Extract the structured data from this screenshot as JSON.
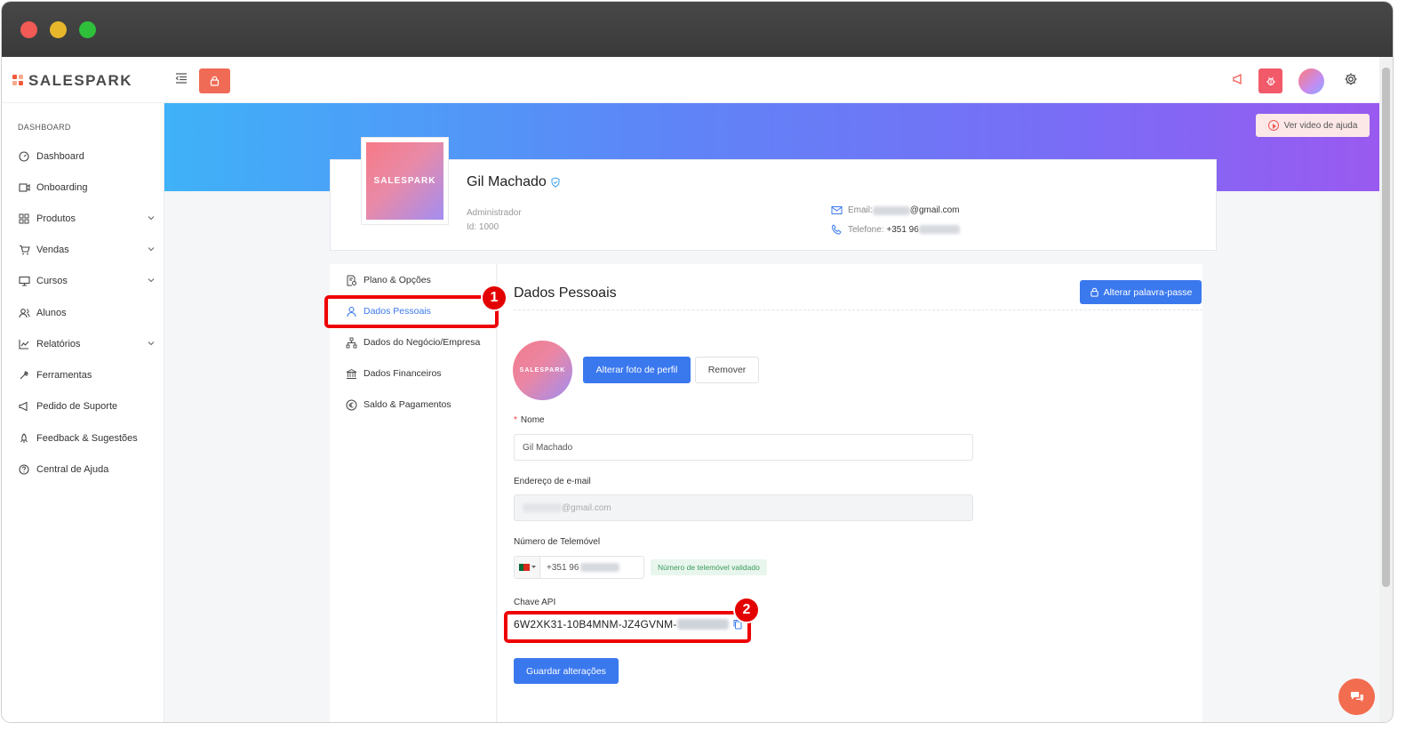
{
  "app": {
    "brand": "SALESPARK"
  },
  "sidebar": {
    "section": "DASHBOARD",
    "items": [
      {
        "label": "Dashboard",
        "icon": "gauge-icon"
      },
      {
        "label": "Onboarding",
        "icon": "video-icon"
      },
      {
        "label": "Produtos",
        "icon": "grid-icon",
        "expandable": true
      },
      {
        "label": "Vendas",
        "icon": "cart-icon",
        "expandable": true
      },
      {
        "label": "Cursos",
        "icon": "monitor-icon",
        "expandable": true
      },
      {
        "label": "Alunos",
        "icon": "users-icon"
      },
      {
        "label": "Relatórios",
        "icon": "chart-icon",
        "expandable": true
      },
      {
        "label": "Ferramentas",
        "icon": "wrench-icon"
      },
      {
        "label": "Pedido de Suporte",
        "icon": "megaphone-icon"
      },
      {
        "label": "Feedback & Sugestões",
        "icon": "rocket-icon"
      },
      {
        "label": "Central de Ajuda",
        "icon": "help-icon"
      }
    ]
  },
  "banner": {
    "help_button": "Ver video de ajuda"
  },
  "profile": {
    "name": "Gil Machado",
    "role": "Administrador",
    "id": "Id: 1000",
    "email_label": "Email:",
    "email_value": "@gmail.com",
    "phone_label": "Telefone:",
    "phone_value": "+351 96"
  },
  "left_menu": {
    "items": [
      {
        "label": "Plano & Opções",
        "icon": "document-settings-icon"
      },
      {
        "label": "Dados Pessoais",
        "icon": "user-icon",
        "active": true
      },
      {
        "label": "Dados do Negócio/Empresa",
        "icon": "sitemap-icon"
      },
      {
        "label": "Dados Financeiros",
        "icon": "bank-icon"
      },
      {
        "label": "Saldo & Pagamentos",
        "icon": "euro-icon"
      }
    ]
  },
  "annotations": {
    "badge1": "1",
    "badge2": "2"
  },
  "form": {
    "title": "Dados Pessoais",
    "change_password": "Alterar palavra-passe",
    "change_photo": "Alterar foto de perfil",
    "remove": "Remover",
    "name_label": "Nome",
    "name_value": "Gil Machado",
    "email_label": "Endereço de e-mail",
    "email_value": "@gmail.com",
    "phone_label": "Número de Telemóvel",
    "phone_value": "+351 96",
    "phone_valid": "Número de telemóvel validado",
    "api_label": "Chave API",
    "api_key": "6W2XK31-10B4MNM-JZ4GVNM-",
    "save": "Guardar alterações"
  },
  "colors": {
    "primary": "#3a78ee",
    "accent": "#f0593d",
    "highlight": "#ee0000"
  }
}
